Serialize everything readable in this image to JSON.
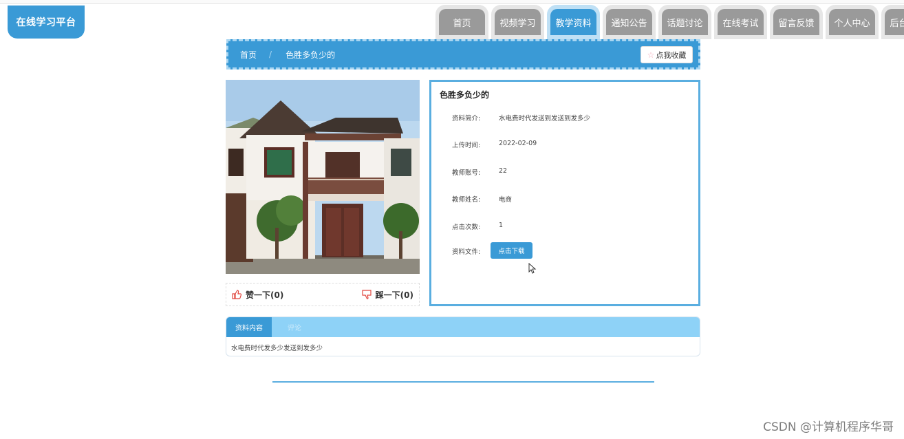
{
  "logo": "在线学习平台",
  "nav": [
    "首页",
    "视频学习",
    "教学资料",
    "通知公告",
    "话题讨论",
    "在线考试",
    "留言反馈",
    "个人中心",
    "后台管理"
  ],
  "nav_active": 2,
  "breadcrumb": {
    "home": "首页",
    "current": "色胜多负少的"
  },
  "fav_button": {
    "icon": "star-icon",
    "label": "点我收藏"
  },
  "vote": {
    "like": "赞一下(0)",
    "dislike": "踩一下(0)"
  },
  "info": {
    "title": "色胜多负少的",
    "rows": [
      {
        "label": "资料简介:",
        "value": "水电费时代发送到发送到发多少"
      },
      {
        "label": "上传时间:",
        "value": "2022-02-09"
      },
      {
        "label": "教师账号:",
        "value": "22"
      },
      {
        "label": "教师姓名:",
        "value": "电商"
      },
      {
        "label": "点击次数:",
        "value": "1"
      },
      {
        "label": "资料文件:",
        "value": ""
      }
    ],
    "download_button": "点击下载"
  },
  "detail": {
    "tabs": [
      "资料内容",
      "评论"
    ],
    "content": "水电费时代发多少发送到发多少"
  },
  "watermark": "CSDN @计算机程序华哥",
  "colors": {
    "primary": "#3a9ad6",
    "light": "#8ed2f7",
    "nav_inactive": "#9a9a9a"
  }
}
